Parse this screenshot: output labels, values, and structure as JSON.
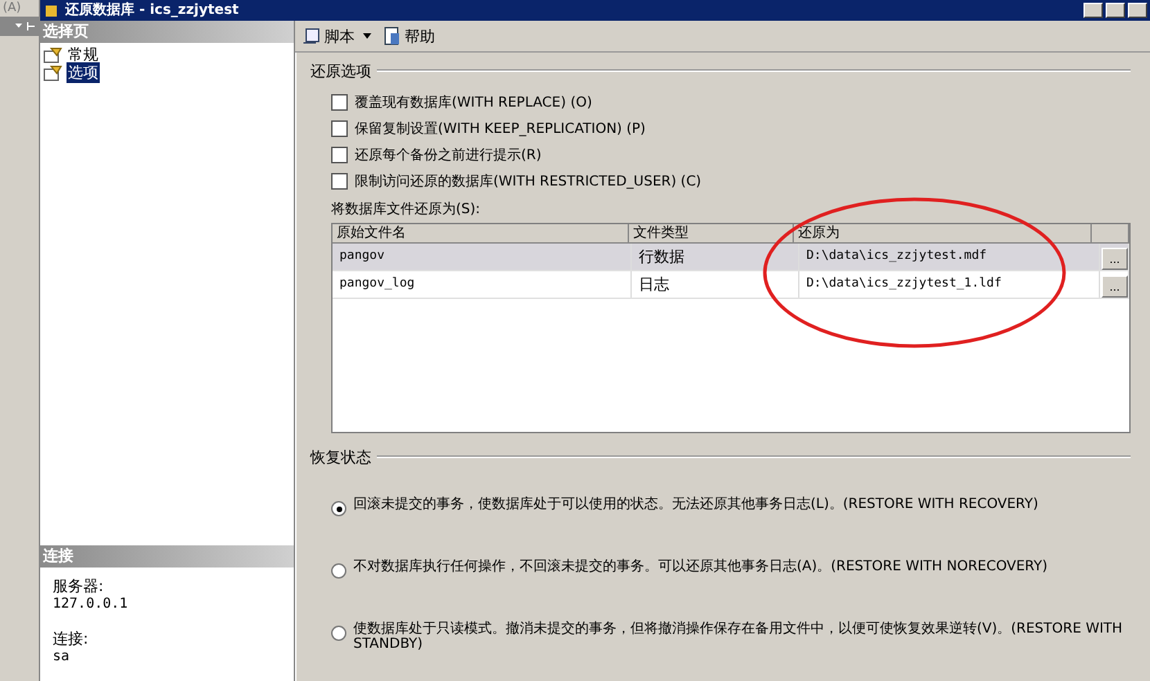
{
  "side_panel": {
    "label": "(A)"
  },
  "window": {
    "title": "还原数据库 - ics_zzjytest"
  },
  "select_page": {
    "header": "选择页",
    "items": [
      {
        "label": "常规",
        "selected": false
      },
      {
        "label": "选项",
        "selected": true
      }
    ]
  },
  "connection": {
    "header": "连接",
    "fields": [
      {
        "label": "服务器:",
        "value": "127.0.0.1"
      },
      {
        "label": "连接:",
        "value": "sa"
      }
    ]
  },
  "toolbar": {
    "items": [
      {
        "label": "脚本",
        "kind": "dropdown"
      },
      {
        "label": "帮助",
        "kind": "help"
      }
    ]
  },
  "restore_options": {
    "title": "还原选项",
    "options": [
      {
        "label": "覆盖现有数据库(WITH REPLACE) (O)",
        "checked": false
      },
      {
        "label": "保留复制设置(WITH KEEP_REPLICATION) (P)",
        "checked": false
      },
      {
        "label": "还原每个备份之前进行提示(R)",
        "checked": false
      },
      {
        "label": "限制访问还原的数据库(WITH RESTRICTED_USER) (C)",
        "checked": false
      }
    ],
    "files_label": "将数据库文件还原为(S):",
    "table": {
      "columns": [
        "原始文件名",
        "文件类型",
        "还原为"
      ],
      "rows": [
        {
          "original": "pangov",
          "type": "行数据",
          "restore_as": "D:\\data\\ics_zzjytest.mdf",
          "button": "...",
          "selected": true
        },
        {
          "original": "pangov_log",
          "type": "日志",
          "restore_as": "D:\\data\\ics_zzjytest_1.ldf",
          "button": "...",
          "selected": false
        }
      ]
    }
  },
  "recovery_state": {
    "title": "恢复状态",
    "options": [
      {
        "label": "回滚未提交的事务，使数据库处于可以使用的状态。无法还原其他事务日志(L)。(RESTORE WITH RECOVERY)",
        "selected": true
      },
      {
        "label": "不对数据库执行任何操作，不回滚未提交的事务。可以还原其他事务日志(A)。(RESTORE WITH NORECOVERY)",
        "selected": false
      },
      {
        "label": "使数据库处于只读模式。撤消未提交的事务，但将撤消操作保存在备用文件中，以便可使恢复效果逆转(V)。(RESTORE WITH STANDBY)",
        "selected": false
      }
    ]
  }
}
